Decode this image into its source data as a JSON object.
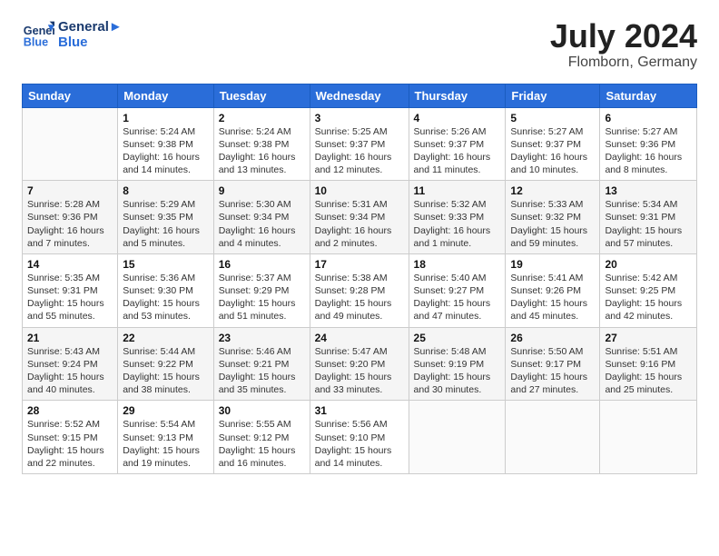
{
  "header": {
    "logo_line1": "General",
    "logo_line2": "Blue",
    "month_title": "July 2024",
    "location": "Flomborn, Germany"
  },
  "weekdays": [
    "Sunday",
    "Monday",
    "Tuesday",
    "Wednesday",
    "Thursday",
    "Friday",
    "Saturday"
  ],
  "weeks": [
    [
      {
        "day": "",
        "info": ""
      },
      {
        "day": "1",
        "info": "Sunrise: 5:24 AM\nSunset: 9:38 PM\nDaylight: 16 hours\nand 14 minutes."
      },
      {
        "day": "2",
        "info": "Sunrise: 5:24 AM\nSunset: 9:38 PM\nDaylight: 16 hours\nand 13 minutes."
      },
      {
        "day": "3",
        "info": "Sunrise: 5:25 AM\nSunset: 9:37 PM\nDaylight: 16 hours\nand 12 minutes."
      },
      {
        "day": "4",
        "info": "Sunrise: 5:26 AM\nSunset: 9:37 PM\nDaylight: 16 hours\nand 11 minutes."
      },
      {
        "day": "5",
        "info": "Sunrise: 5:27 AM\nSunset: 9:37 PM\nDaylight: 16 hours\nand 10 minutes."
      },
      {
        "day": "6",
        "info": "Sunrise: 5:27 AM\nSunset: 9:36 PM\nDaylight: 16 hours\nand 8 minutes."
      }
    ],
    [
      {
        "day": "7",
        "info": "Sunrise: 5:28 AM\nSunset: 9:36 PM\nDaylight: 16 hours\nand 7 minutes."
      },
      {
        "day": "8",
        "info": "Sunrise: 5:29 AM\nSunset: 9:35 PM\nDaylight: 16 hours\nand 5 minutes."
      },
      {
        "day": "9",
        "info": "Sunrise: 5:30 AM\nSunset: 9:34 PM\nDaylight: 16 hours\nand 4 minutes."
      },
      {
        "day": "10",
        "info": "Sunrise: 5:31 AM\nSunset: 9:34 PM\nDaylight: 16 hours\nand 2 minutes."
      },
      {
        "day": "11",
        "info": "Sunrise: 5:32 AM\nSunset: 9:33 PM\nDaylight: 16 hours\nand 1 minute."
      },
      {
        "day": "12",
        "info": "Sunrise: 5:33 AM\nSunset: 9:32 PM\nDaylight: 15 hours\nand 59 minutes."
      },
      {
        "day": "13",
        "info": "Sunrise: 5:34 AM\nSunset: 9:31 PM\nDaylight: 15 hours\nand 57 minutes."
      }
    ],
    [
      {
        "day": "14",
        "info": "Sunrise: 5:35 AM\nSunset: 9:31 PM\nDaylight: 15 hours\nand 55 minutes."
      },
      {
        "day": "15",
        "info": "Sunrise: 5:36 AM\nSunset: 9:30 PM\nDaylight: 15 hours\nand 53 minutes."
      },
      {
        "day": "16",
        "info": "Sunrise: 5:37 AM\nSunset: 9:29 PM\nDaylight: 15 hours\nand 51 minutes."
      },
      {
        "day": "17",
        "info": "Sunrise: 5:38 AM\nSunset: 9:28 PM\nDaylight: 15 hours\nand 49 minutes."
      },
      {
        "day": "18",
        "info": "Sunrise: 5:40 AM\nSunset: 9:27 PM\nDaylight: 15 hours\nand 47 minutes."
      },
      {
        "day": "19",
        "info": "Sunrise: 5:41 AM\nSunset: 9:26 PM\nDaylight: 15 hours\nand 45 minutes."
      },
      {
        "day": "20",
        "info": "Sunrise: 5:42 AM\nSunset: 9:25 PM\nDaylight: 15 hours\nand 42 minutes."
      }
    ],
    [
      {
        "day": "21",
        "info": "Sunrise: 5:43 AM\nSunset: 9:24 PM\nDaylight: 15 hours\nand 40 minutes."
      },
      {
        "day": "22",
        "info": "Sunrise: 5:44 AM\nSunset: 9:22 PM\nDaylight: 15 hours\nand 38 minutes."
      },
      {
        "day": "23",
        "info": "Sunrise: 5:46 AM\nSunset: 9:21 PM\nDaylight: 15 hours\nand 35 minutes."
      },
      {
        "day": "24",
        "info": "Sunrise: 5:47 AM\nSunset: 9:20 PM\nDaylight: 15 hours\nand 33 minutes."
      },
      {
        "day": "25",
        "info": "Sunrise: 5:48 AM\nSunset: 9:19 PM\nDaylight: 15 hours\nand 30 minutes."
      },
      {
        "day": "26",
        "info": "Sunrise: 5:50 AM\nSunset: 9:17 PM\nDaylight: 15 hours\nand 27 minutes."
      },
      {
        "day": "27",
        "info": "Sunrise: 5:51 AM\nSunset: 9:16 PM\nDaylight: 15 hours\nand 25 minutes."
      }
    ],
    [
      {
        "day": "28",
        "info": "Sunrise: 5:52 AM\nSunset: 9:15 PM\nDaylight: 15 hours\nand 22 minutes."
      },
      {
        "day": "29",
        "info": "Sunrise: 5:54 AM\nSunset: 9:13 PM\nDaylight: 15 hours\nand 19 minutes."
      },
      {
        "day": "30",
        "info": "Sunrise: 5:55 AM\nSunset: 9:12 PM\nDaylight: 15 hours\nand 16 minutes."
      },
      {
        "day": "31",
        "info": "Sunrise: 5:56 AM\nSunset: 9:10 PM\nDaylight: 15 hours\nand 14 minutes."
      },
      {
        "day": "",
        "info": ""
      },
      {
        "day": "",
        "info": ""
      },
      {
        "day": "",
        "info": ""
      }
    ]
  ]
}
